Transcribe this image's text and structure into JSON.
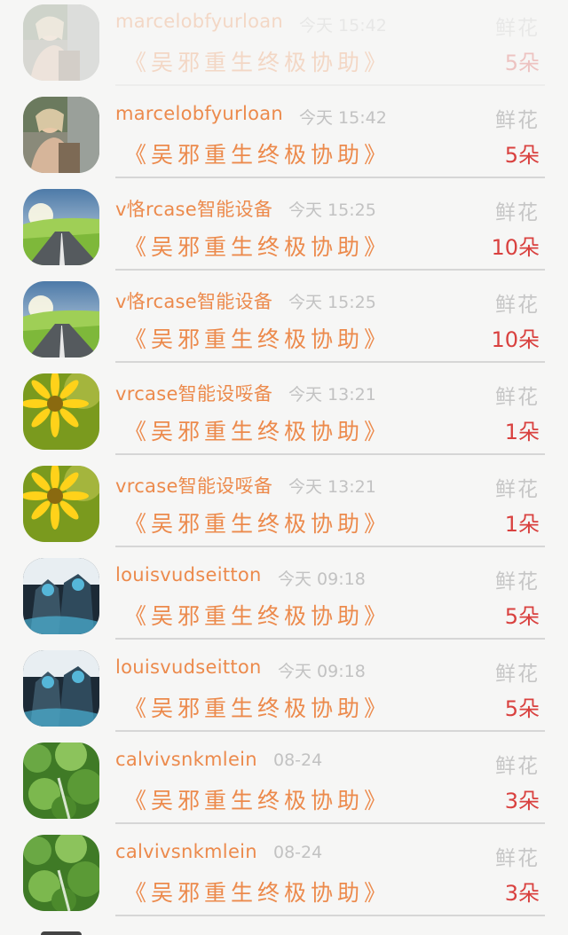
{
  "book_title": "《吴邪重生终极协助》",
  "gift_label": "鲜花",
  "rows": [
    {
      "name": "marcelobfyurloan",
      "time": "今天 15:42",
      "count": "5朵",
      "avatar": "photo-girl-avatar",
      "faded": true
    },
    {
      "name": "marcelobfyurloan",
      "time": "今天 15:42",
      "count": "5朵",
      "avatar": "photo-girl-avatar",
      "faded": false
    },
    {
      "name": "v恪rcase智能设备",
      "time": "今天 15:25",
      "count": "10朵",
      "avatar": "road-landscape-avatar",
      "faded": false
    },
    {
      "name": "v恪rcase智能设备",
      "time": "今天 15:25",
      "count": "10朵",
      "avatar": "road-landscape-avatar",
      "faded": false
    },
    {
      "name": "vrcase智能设哸备",
      "time": "今天 13:21",
      "count": "1朵",
      "avatar": "yellow-flower-avatar",
      "faded": false
    },
    {
      "name": "vrcase智能设哸备",
      "time": "今天 13:21",
      "count": "1朵",
      "avatar": "yellow-flower-avatar",
      "faded": false
    },
    {
      "name": "louisvudseitton",
      "time": "今天 09:18",
      "count": "5朵",
      "avatar": "armored-warrior-avatar",
      "faded": false
    },
    {
      "name": "louisvudseitton",
      "time": "今天 09:18",
      "count": "5朵",
      "avatar": "armored-warrior-avatar",
      "faded": false
    },
    {
      "name": "calvivsnkmlein",
      "time": "08-24",
      "count": "3朵",
      "avatar": "green-foliage-avatar",
      "faded": false
    },
    {
      "name": "calvivsnkmlein",
      "time": "08-24",
      "count": "3朵",
      "avatar": "green-foliage-avatar",
      "faded": false
    }
  ],
  "colors": {
    "name": "#ec8a4c",
    "time": "#c2c2c2",
    "gift_count": "#d9413f",
    "background": "#f6f6f5"
  }
}
